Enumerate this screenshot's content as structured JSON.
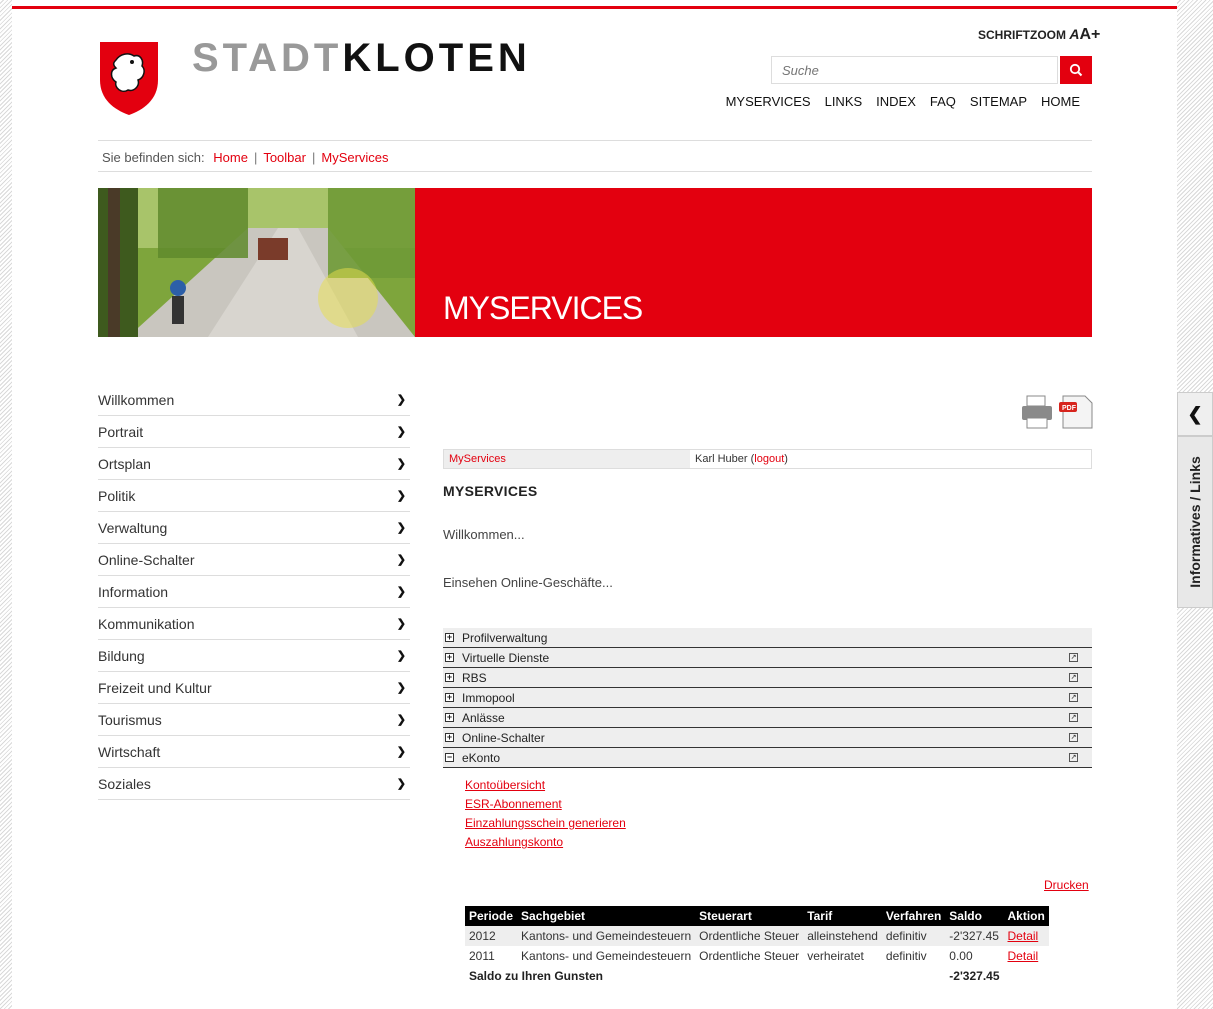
{
  "header": {
    "brand_light": "STADT",
    "brand_dark": "KLOTEN",
    "fontzoom_label": "SCHRIFTZOOM",
    "search_placeholder": "Suche",
    "topnav": [
      "MYSERVICES",
      "LINKS",
      "INDEX",
      "FAQ",
      "SITEMAP",
      "HOME"
    ]
  },
  "breadcrumb": {
    "prefix": "Sie befinden sich:",
    "items": [
      "Home",
      "Toolbar",
      "MyServices"
    ]
  },
  "hero": {
    "title": "MYSERVICES"
  },
  "side_tab": {
    "label": "Informatives / Links"
  },
  "leftnav": [
    "Willkommen",
    "Portrait",
    "Ortsplan",
    "Politik",
    "Verwaltung",
    "Online-Schalter",
    "Information",
    "Kommunikation",
    "Bildung",
    "Freizeit und Kultur",
    "Tourismus",
    "Wirtschaft",
    "Soziales"
  ],
  "userbar": {
    "link": "MyServices",
    "user": "Karl Huber (",
    "logout": "logout",
    "close": ")"
  },
  "main": {
    "heading": "MYSERVICES",
    "welcome": "Willkommen...",
    "intro": "Einsehen Online-Geschäfte..."
  },
  "accordion": [
    {
      "label": "Profilverwaltung",
      "state": "+",
      "ext": false
    },
    {
      "label": "Virtuelle Dienste",
      "state": "+",
      "ext": true
    },
    {
      "label": "RBS",
      "state": "+",
      "ext": true
    },
    {
      "label": "Immopool",
      "state": "+",
      "ext": true
    },
    {
      "label": "Anlässe",
      "state": "+",
      "ext": true
    },
    {
      "label": "Online-Schalter",
      "state": "+",
      "ext": true
    },
    {
      "label": "eKonto",
      "state": "−",
      "ext": true
    }
  ],
  "ekonto_links": [
    "Kontoübersicht",
    "ESR-Abonnement",
    "Einzahlungsschein generieren",
    "Auszahlungskonto"
  ],
  "print_link": "Drucken",
  "tax_table": {
    "headers": [
      "Periode",
      "Sachgebiet",
      "Steuerart",
      "Tarif",
      "Verfahren",
      "Saldo",
      "Aktion"
    ],
    "rows": [
      [
        "2012",
        "Kantons- und Gemeindesteuern",
        "Ordentliche Steuer",
        "alleinstehend",
        "definitiv",
        "-2'327.45",
        "Detail"
      ],
      [
        "2011",
        "Kantons- und Gemeindesteuern",
        "Ordentliche Steuer",
        "verheiratet",
        "definitiv",
        "0.00",
        "Detail"
      ]
    ],
    "sum_label": "Saldo zu Ihren Gunsten",
    "sum_value": "-2'327.45"
  },
  "colors": {
    "accent": "#e3000f"
  }
}
